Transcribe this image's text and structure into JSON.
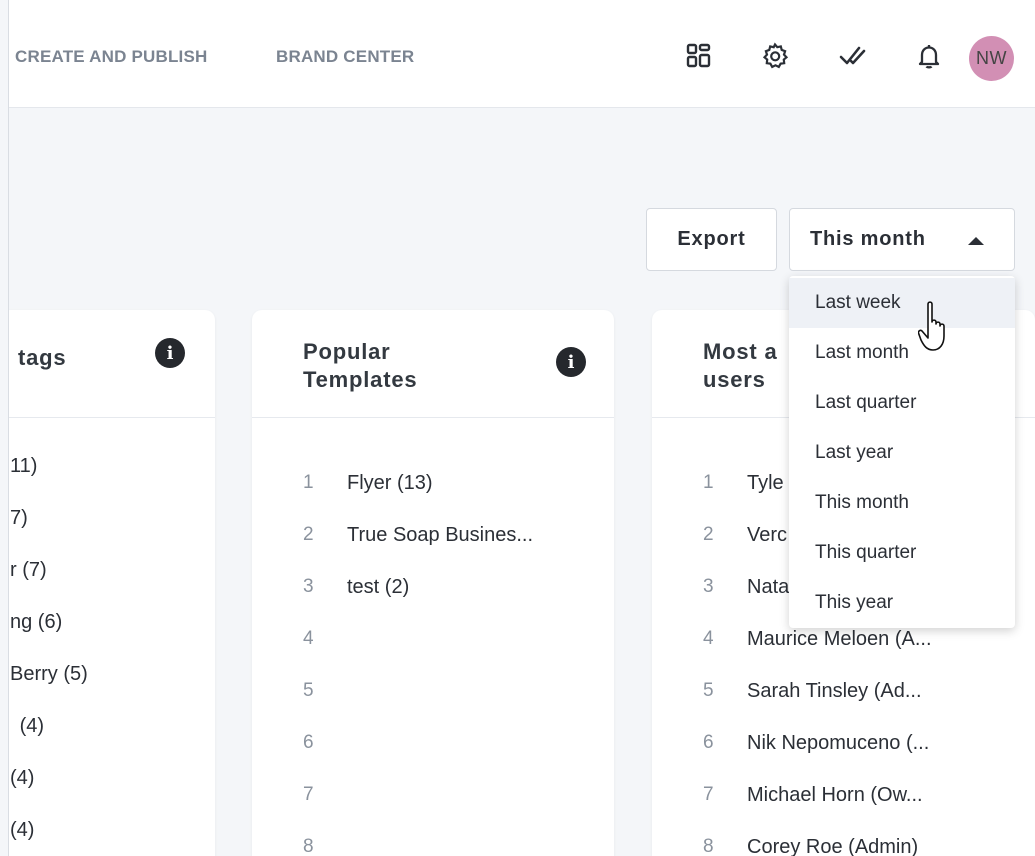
{
  "nav": {
    "create_publish": "CREATE AND PUBLISH",
    "brand_center": "BRAND CENTER"
  },
  "icons": {
    "apps": "apps-grid-icon",
    "settings": "gear-icon",
    "tasks": "double-check-icon",
    "notifications": "bell-icon"
  },
  "user": {
    "initials": "NW",
    "avatar_color": "#d28fb4"
  },
  "toolbar": {
    "export_label": "Export",
    "period_label": "This month"
  },
  "dropdown": {
    "options": [
      "Last week",
      "Last month",
      "Last quarter",
      "Last year",
      "This month",
      "This quarter",
      "This year"
    ],
    "hovered": "Last week"
  },
  "cards": {
    "tags": {
      "title": "tags",
      "rows": [
        "11)",
        "7)",
        "r (7)",
        "ng (6)",
        " Berry (5)",
        " (4)",
        "(4)",
        "(4)"
      ]
    },
    "templates": {
      "title_line1": "Popular",
      "title_line2": "Templates",
      "rows": [
        {
          "n": "1",
          "text": "Flyer (13)"
        },
        {
          "n": "2",
          "text": "True Soap Busines..."
        },
        {
          "n": "3",
          "text": "test (2)"
        },
        {
          "n": "4",
          "text": ""
        },
        {
          "n": "5",
          "text": ""
        },
        {
          "n": "6",
          "text": ""
        },
        {
          "n": "7",
          "text": ""
        },
        {
          "n": "8",
          "text": ""
        }
      ]
    },
    "users": {
      "title_line1": "Most a",
      "title_line2": "users",
      "rows": [
        {
          "n": "1",
          "text": "Tyle"
        },
        {
          "n": "2",
          "text": "Verc"
        },
        {
          "n": "3",
          "text": "Nata"
        },
        {
          "n": "4",
          "text": "Maurice Meloen (A..."
        },
        {
          "n": "5",
          "text": "Sarah Tinsley (Ad..."
        },
        {
          "n": "6",
          "text": "Nik Nepomuceno (..."
        },
        {
          "n": "7",
          "text": "Michael Horn (Ow..."
        },
        {
          "n": "8",
          "text": "Corey Roe (Admin)"
        }
      ]
    }
  },
  "colors": {
    "link": "#2e6fd8",
    "muted_number": "#8a929d",
    "nav_text": "#7b8491"
  }
}
